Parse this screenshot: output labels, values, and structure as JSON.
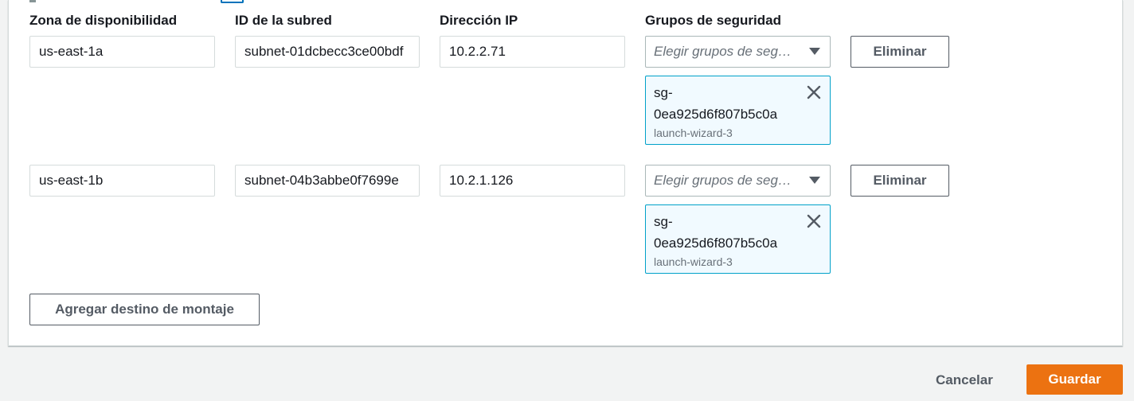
{
  "headers": {
    "zone": "Zona de disponibilidad",
    "subnet": "ID de la subred",
    "ip": "Dirección IP",
    "groups": "Grupos de seguridad"
  },
  "targets": [
    {
      "zone": "us-east-1a",
      "subnet": "subnet-01dcbecc3ce00bdf",
      "ip": "10.2.2.71",
      "select_placeholder": "Elegir grupos de seg…",
      "remove_label": "Eliminar",
      "group_id_line1": "sg-",
      "group_id_line2": "0ea925d6f807b5c0a",
      "group_name": "launch-wizard-3"
    },
    {
      "zone": "us-east-1b",
      "subnet": "subnet-04b3abbe0f7699e",
      "ip": "10.2.1.126",
      "select_placeholder": "Elegir grupos de seg…",
      "remove_label": "Eliminar",
      "group_id_line1": "sg-",
      "group_id_line2": "0ea925d6f807b5c0a",
      "group_name": "launch-wizard-3"
    }
  ],
  "add_target_label": "Agregar destino de montaje",
  "footer": {
    "cancel_label": "Cancelar",
    "save_label": "Guardar"
  },
  "colors": {
    "primary": "#ec7211",
    "token_border": "#00a1c9",
    "token_bg": "#f1faff"
  }
}
